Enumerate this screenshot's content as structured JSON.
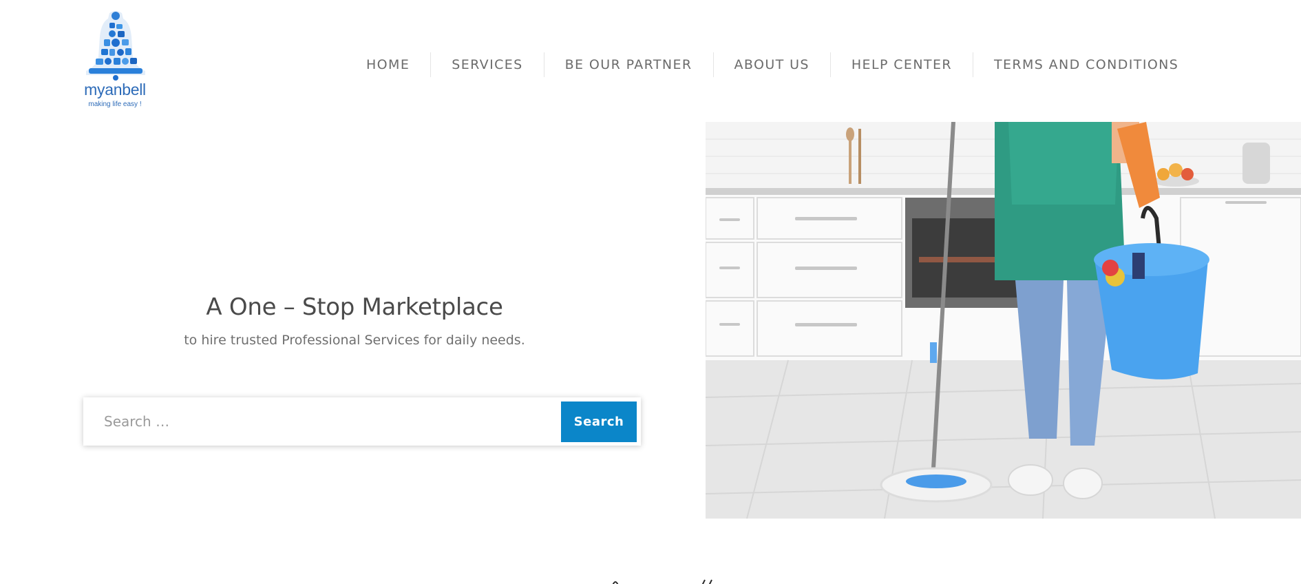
{
  "brand": {
    "name": "myanbell",
    "tagline": "making life easy !",
    "color": "#2d6bb8",
    "logo_icon": "bell-icon"
  },
  "nav": {
    "items": [
      {
        "label": "HOME"
      },
      {
        "label": "SERVICES"
      },
      {
        "label": "BE OUR PARTNER"
      },
      {
        "label": "ABOUT US"
      },
      {
        "label": "HELP CENTER"
      },
      {
        "label": "TERMS AND CONDITIONS"
      }
    ]
  },
  "hero": {
    "title": "A One – Stop Marketplace",
    "subtitle": "to hire trusted Professional Services for daily needs.",
    "image_alt": "cleaner-mopping-kitchen-photo"
  },
  "search": {
    "placeholder": "Search …",
    "value": "",
    "button_label": "Search",
    "accent": "#0b86c9"
  }
}
